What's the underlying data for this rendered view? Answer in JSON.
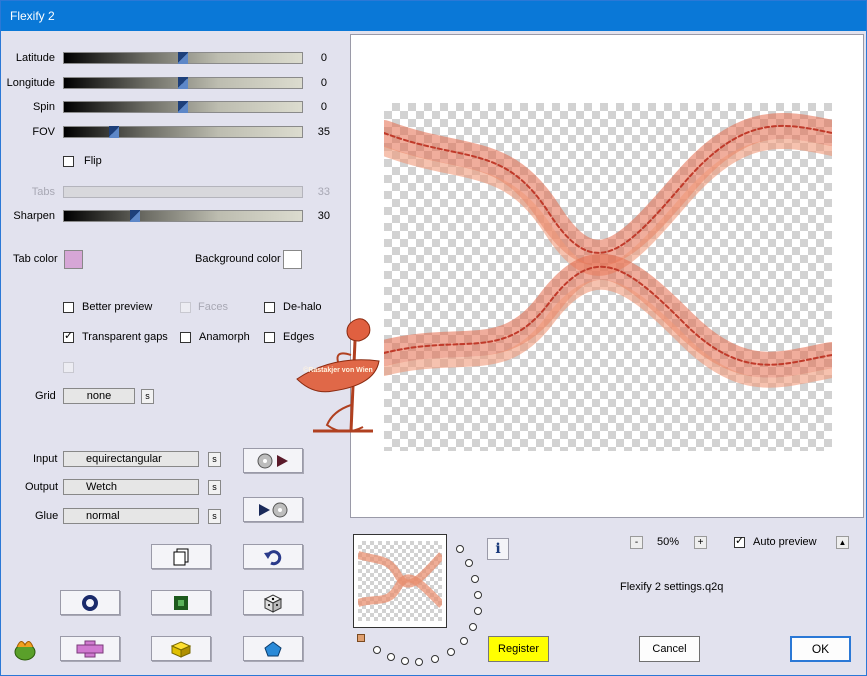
{
  "window": {
    "title": "Flexify 2"
  },
  "sliders": [
    {
      "id": "latitude",
      "label": "Latitude",
      "value": "0",
      "fraction": 0.5
    },
    {
      "id": "longitude",
      "label": "Longitude",
      "value": "0",
      "fraction": 0.5
    },
    {
      "id": "spin",
      "label": "Spin",
      "value": "0",
      "fraction": 0.5
    },
    {
      "id": "fov",
      "label": "FOV",
      "value": "35",
      "fraction": 0.21
    },
    {
      "id": "tabs",
      "label": "Tabs",
      "value": "33",
      "fraction": null
    },
    {
      "id": "sharpen",
      "label": "Sharpen",
      "value": "30",
      "fraction": 0.3
    }
  ],
  "flip": {
    "label": "Flip",
    "checked": false
  },
  "colors": {
    "tab_label": "Tab color",
    "tab_color": "#d6a6d6",
    "bg_label": "Background color",
    "bg_color": "#ffffff"
  },
  "options": {
    "better_preview": "Better preview",
    "faces": "Faces",
    "dehalo": "De-halo",
    "transparent_gaps": "Transparent gaps",
    "anamorph": "Anamorph",
    "edges": "Edges"
  },
  "grid": {
    "label": "Grid",
    "value": "none",
    "s": "s"
  },
  "projection": {
    "input_label": "Input",
    "input_value": "equirectangular",
    "output_label": "Output",
    "output_value": "Wetch",
    "glue_label": "Glue",
    "glue_value": "normal",
    "s": "s"
  },
  "watermark": {
    "text": "©Rastakjer von Wien"
  },
  "zoom": {
    "minus": "-",
    "value": "50%",
    "plus": "+"
  },
  "auto_preview": {
    "label": "Auto preview",
    "checked": true,
    "arrow": "▲"
  },
  "settings_file": "Flexify 2 settings.q2q",
  "buttons": {
    "register": "Register",
    "cancel": "Cancel",
    "ok": "OK",
    "info": "i"
  },
  "colors_ui": {
    "titlebar": "#0a78d7",
    "register": "#ffff00",
    "accent": "#2b78d6"
  }
}
